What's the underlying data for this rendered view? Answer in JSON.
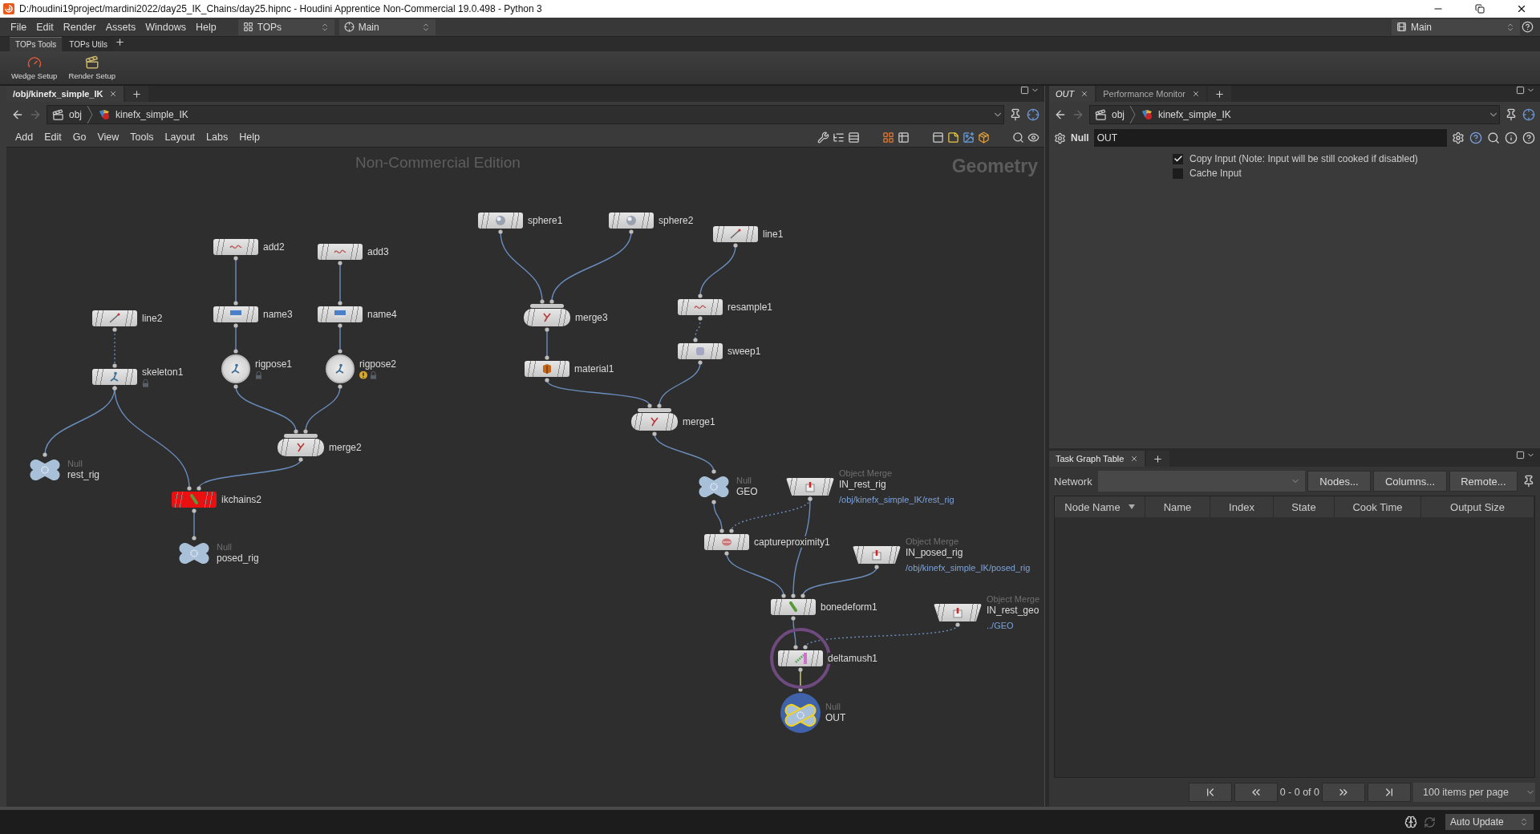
{
  "window": {
    "title": "D:/houdini19project/mardini2022/day25_IK_Chains/day25.hipnc - Houdini Apprentice Non-Commercial 19.0.498 - Python 3"
  },
  "main_menu": [
    "File",
    "Edit",
    "Render",
    "Assets",
    "Windows",
    "Help"
  ],
  "desktop_selector": {
    "value": "TOPs"
  },
  "context_selector": {
    "value": "Main"
  },
  "right_selector": {
    "value": "Main"
  },
  "shelf_tabs": [
    {
      "label": "TOPs Tools",
      "selected": true
    },
    {
      "label": "TOPs Utils",
      "selected": false
    }
  ],
  "shelf_tools": [
    "Wedge Setup",
    "Render Setup"
  ],
  "network_pane": {
    "tabs": [
      {
        "label": "/obj/kinefx_simple_IK",
        "selected": true
      }
    ],
    "path": [
      "obj",
      "kinefx_simple_IK"
    ],
    "menu": [
      "Add",
      "Edit",
      "Go",
      "View",
      "Tools",
      "Layout",
      "Labs",
      "Help"
    ],
    "overlay": "Non-Commercial Edition",
    "context_label": "Geometry",
    "nodes": [
      {
        "name": "sphere1",
        "kind": "box",
        "error": false,
        "warning": false,
        "locked": false,
        "display": false,
        "ring": false
      },
      {
        "name": "sphere2",
        "kind": "box",
        "error": false,
        "warning": false,
        "locked": false,
        "display": false,
        "ring": false
      },
      {
        "name": "line1",
        "kind": "box",
        "error": false,
        "warning": false,
        "locked": false,
        "display": false,
        "ring": false
      },
      {
        "name": "add2",
        "kind": "box",
        "error": false,
        "warning": false,
        "locked": false,
        "display": false,
        "ring": false
      },
      {
        "name": "add3",
        "kind": "box",
        "error": false,
        "warning": false,
        "locked": false,
        "display": false,
        "ring": false
      },
      {
        "name": "name3",
        "kind": "box",
        "error": false,
        "warning": false,
        "locked": false,
        "display": false,
        "ring": false
      },
      {
        "name": "name4",
        "kind": "box",
        "error": false,
        "warning": false,
        "locked": false,
        "display": false,
        "ring": false
      },
      {
        "name": "line2",
        "kind": "box",
        "error": false,
        "warning": false,
        "locked": false,
        "display": false,
        "ring": false
      },
      {
        "name": "resample1",
        "kind": "box",
        "error": false,
        "warning": false,
        "locked": false,
        "display": false,
        "ring": false
      },
      {
        "name": "merge3",
        "kind": "merge",
        "error": false,
        "warning": false,
        "locked": false,
        "display": false,
        "ring": false
      },
      {
        "name": "skeleton1",
        "kind": "box",
        "error": false,
        "warning": false,
        "locked": true,
        "display": false,
        "ring": false
      },
      {
        "name": "rigpose1",
        "kind": "round",
        "error": false,
        "warning": false,
        "locked": true,
        "display": false,
        "ring": false
      },
      {
        "name": "rigpose2",
        "kind": "round",
        "error": false,
        "warning": true,
        "locked": true,
        "display": false,
        "ring": false
      },
      {
        "name": "sweep1",
        "kind": "box",
        "error": false,
        "warning": false,
        "locked": false,
        "display": false,
        "ring": false
      },
      {
        "name": "material1",
        "kind": "box",
        "error": false,
        "warning": false,
        "locked": false,
        "display": false,
        "ring": false
      },
      {
        "name": "merge1",
        "kind": "merge",
        "error": false,
        "warning": false,
        "locked": false,
        "display": false,
        "ring": false
      },
      {
        "name": "merge2",
        "kind": "merge",
        "error": false,
        "warning": false,
        "locked": false,
        "display": false,
        "ring": false
      },
      {
        "name": "rest_rig",
        "kind": "null",
        "type_label": "Null",
        "error": false,
        "warning": false,
        "locked": false,
        "display": false,
        "ring": false
      },
      {
        "name": "ikchains2",
        "kind": "box",
        "error": true,
        "warning": false,
        "locked": false,
        "display": false,
        "ring": false
      },
      {
        "name": "GEO",
        "kind": "null",
        "type_label": "Null",
        "error": false,
        "warning": false,
        "locked": false,
        "display": false,
        "ring": false
      },
      {
        "name": "IN_rest_rig",
        "kind": "object_merge",
        "type_label": "Object Merge",
        "path": "/obj/kinefx_simple_IK/rest_rig",
        "error": false,
        "warning": false,
        "locked": false,
        "display": false,
        "ring": false
      },
      {
        "name": "posed_rig",
        "kind": "null",
        "type_label": "Null",
        "error": false,
        "warning": false,
        "locked": false,
        "display": false,
        "ring": false
      },
      {
        "name": "captureproximity1",
        "kind": "box",
        "error": false,
        "warning": false,
        "locked": false,
        "display": false,
        "ring": false
      },
      {
        "name": "IN_posed_rig",
        "kind": "object_merge",
        "type_label": "Object Merge",
        "path": "/obj/kinefx_simple_IK/posed_rig",
        "error": false,
        "warning": false,
        "locked": false,
        "display": false,
        "ring": false
      },
      {
        "name": "bonedeform1",
        "kind": "box",
        "error": false,
        "warning": false,
        "locked": false,
        "display": false,
        "ring": false
      },
      {
        "name": "IN_rest_geo",
        "kind": "object_merge",
        "type_label": "Object Merge",
        "path": "../GEO",
        "error": false,
        "warning": false,
        "locked": false,
        "display": false,
        "ring": false
      },
      {
        "name": "deltamush1",
        "kind": "box",
        "error": false,
        "warning": false,
        "locked": false,
        "display": false,
        "ring": true
      },
      {
        "name": "OUT",
        "kind": "null",
        "type_label": "Null",
        "error": false,
        "warning": false,
        "locked": false,
        "display": true,
        "ring": false
      }
    ]
  },
  "parameter_pane": {
    "tabs": [
      {
        "label": "OUT",
        "selected": true
      },
      {
        "label": "Performance Monitor",
        "selected": false
      }
    ],
    "path": [
      "obj",
      "kinefx_simple_IK"
    ],
    "node_type": "Null",
    "node_name": "OUT",
    "parameters": [
      {
        "label": "Copy Input (Note: Input will be still cooked if disabled)",
        "checked": true
      },
      {
        "label": "Cache Input",
        "checked": false
      }
    ]
  },
  "task_graph_pane": {
    "tabs": [
      {
        "label": "Task Graph Table",
        "selected": true
      }
    ],
    "network_label": "Network",
    "buttons": [
      "Nodes...",
      "Columns...",
      "Remote..."
    ],
    "columns": [
      "Node Name",
      "Name",
      "Index",
      "State",
      "Cook Time",
      "Output Size"
    ],
    "range": "0 - 0 of 0",
    "page_size": "100 items per page"
  },
  "status_bar": {
    "update_mode": "Auto Update"
  }
}
